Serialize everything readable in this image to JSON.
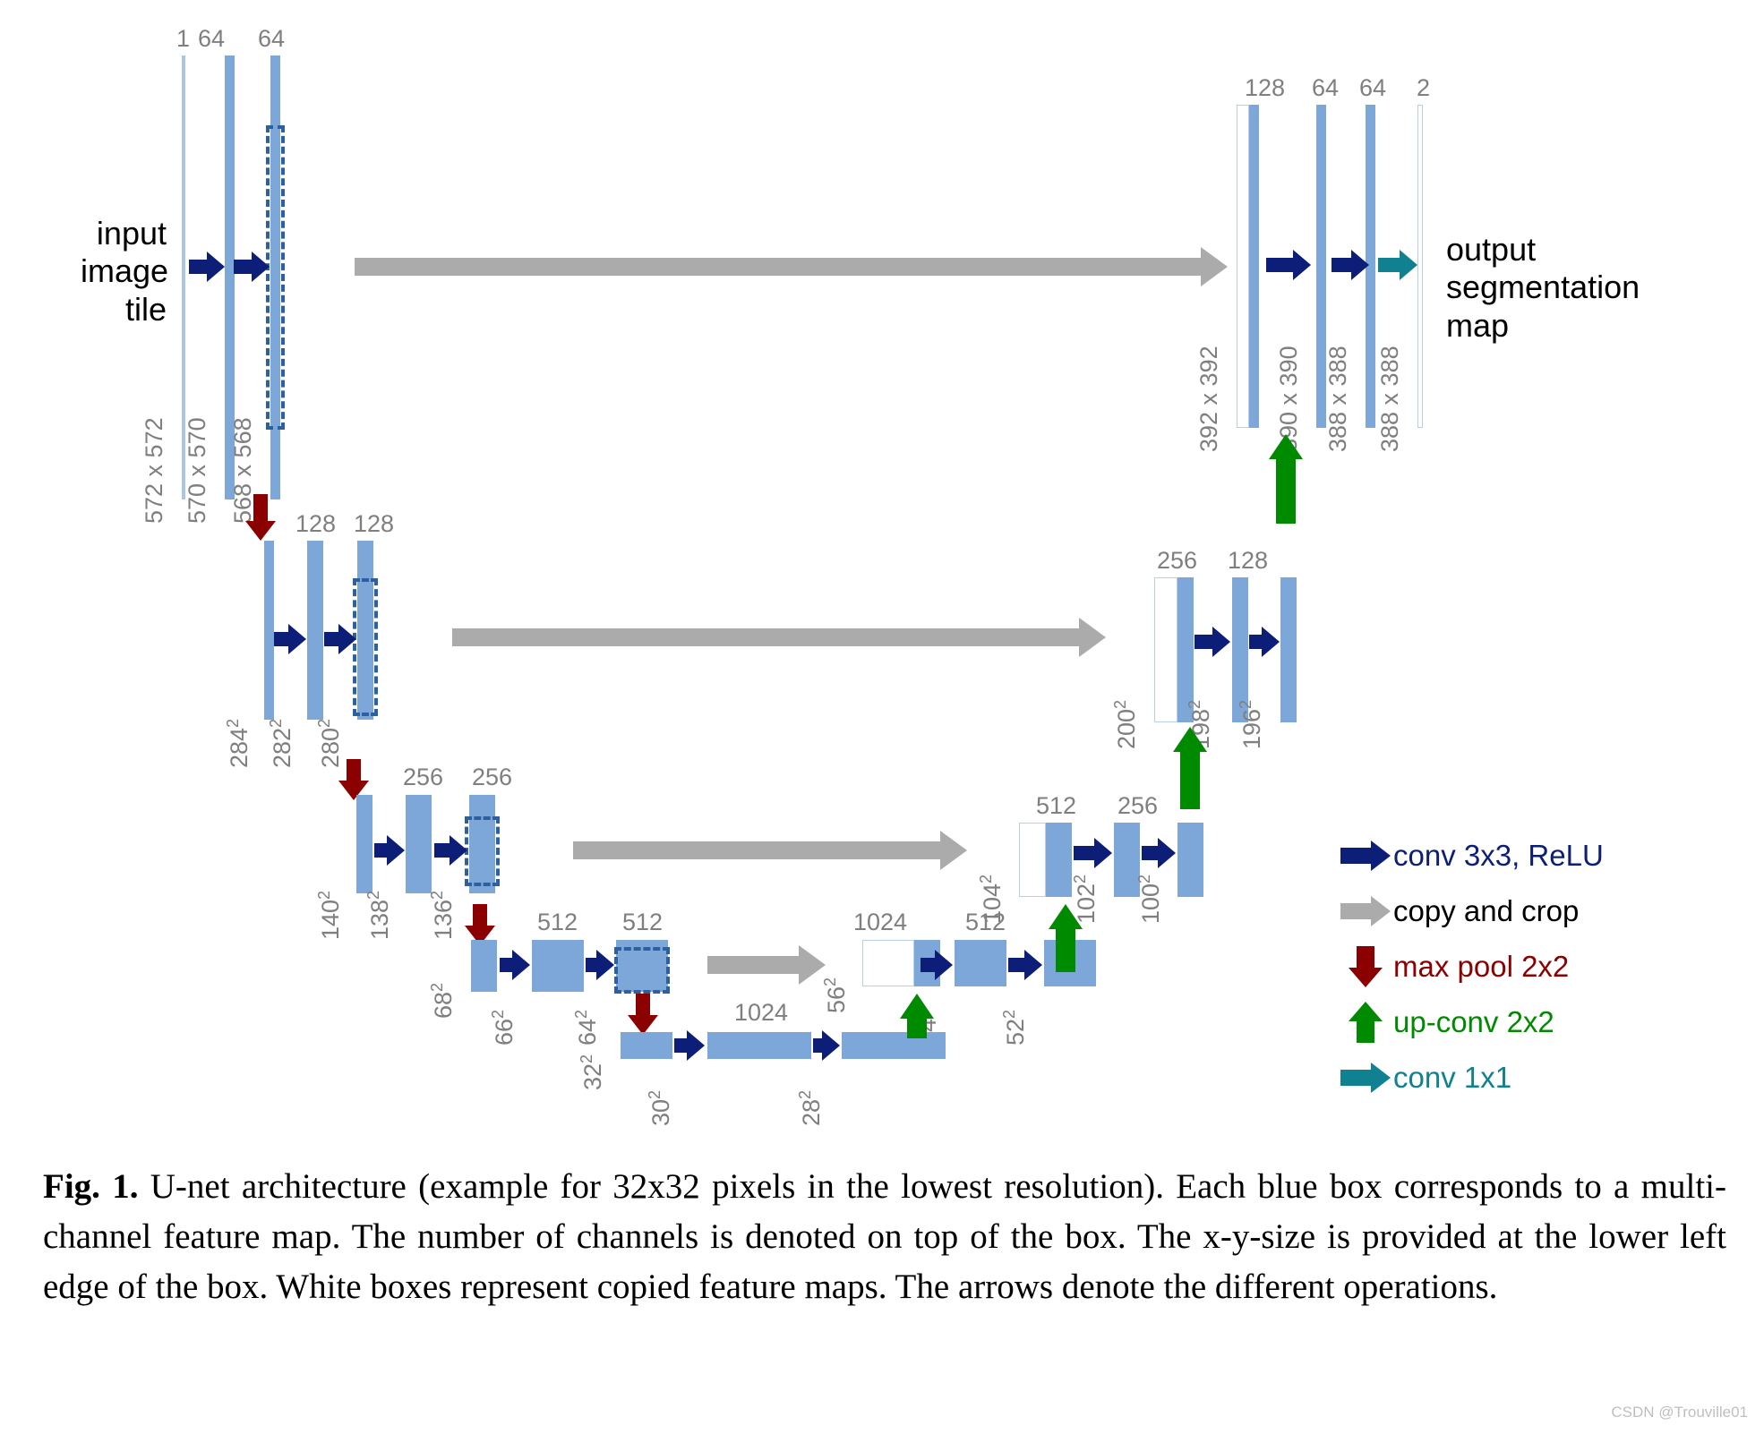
{
  "figure": {
    "caption_label": "Fig. 1.",
    "caption_text": "U-net architecture (example for 32x32 pixels in the lowest resolution). Each blue box corresponds to a multi-channel feature map. The number of channels is denoted on top of the box. The x-y-size is provided at the lower left edge of the box. White boxes represent copied feature maps. The arrows denote the different operations.",
    "watermark": "CSDN @Trouville01"
  },
  "annotations": {
    "input_label": "input\nimage\ntile",
    "input_line1": "input",
    "input_line2": "image",
    "input_line3": "tile",
    "output_line1": "output",
    "output_line2": "segmentation",
    "output_line3": "map"
  },
  "colors": {
    "feature_map_blue": "#7DA7D9",
    "channel_label_gray": "#7F7F7F",
    "conv_arrow": "#0D1E78",
    "copy_arrow": "#ABABAB",
    "maxpool_arrow": "#8B0000",
    "upconv_arrow": "#008A00",
    "conv1x1_arrow": "#0F8190",
    "white_box_border": "#B8CFE8",
    "dashed_border": "#2E5F9E"
  },
  "legend": [
    {
      "icon": "right-arrow-icon",
      "label": "conv 3x3, ReLU",
      "color": "#0D1E78"
    },
    {
      "icon": "right-arrow-icon",
      "label": "copy and crop",
      "color": "#ABABAB",
      "label_color": "#000000"
    },
    {
      "icon": "down-arrow-icon",
      "label": "max pool 2x2",
      "color": "#8B0000"
    },
    {
      "icon": "up-arrow-icon",
      "label": "up-conv 2x2",
      "color": "#008A00"
    },
    {
      "icon": "right-arrow-icon",
      "label": "conv 1x1",
      "color": "#0F8190"
    }
  ],
  "chart_data": {
    "type": "diagram",
    "title": "U-net architecture",
    "levels": [
      {
        "level": 1,
        "encoder": [
          {
            "channels": "1",
            "size": "572 x 572"
          },
          {
            "channels": "64",
            "size": "570 x 570"
          },
          {
            "channels": "64",
            "size": "568 x 568"
          }
        ],
        "decoder": [
          {
            "channels": "128",
            "size": "392 x 392",
            "copied": true
          },
          {
            "channels": "64",
            "size": "390 x 390"
          },
          {
            "channels": "64",
            "size": "388 x 388"
          },
          {
            "channels": "2",
            "size": "388 x 388"
          }
        ]
      },
      {
        "level": 2,
        "encoder": [
          {
            "channels": "",
            "size": "284²"
          },
          {
            "channels": "128",
            "size": "282²"
          },
          {
            "channels": "128",
            "size": "280²"
          }
        ],
        "decoder": [
          {
            "channels": "256",
            "size": "200²",
            "copied": true
          },
          {
            "channels": "128",
            "size": "198²"
          },
          {
            "channels": "",
            "size": "196²"
          }
        ]
      },
      {
        "level": 3,
        "encoder": [
          {
            "channels": "",
            "size": "140²"
          },
          {
            "channels": "256",
            "size": "138²"
          },
          {
            "channels": "256",
            "size": "136²"
          }
        ],
        "decoder": [
          {
            "channels": "512",
            "size": "104²",
            "copied": true
          },
          {
            "channels": "256",
            "size": "102²"
          },
          {
            "channels": "",
            "size": "100²"
          }
        ]
      },
      {
        "level": 4,
        "encoder": [
          {
            "channels": "",
            "size": "68²"
          },
          {
            "channels": "512",
            "size": "66²"
          },
          {
            "channels": "512",
            "size": "64²"
          }
        ],
        "decoder": [
          {
            "channels": "1024",
            "size": "56²",
            "copied": true
          },
          {
            "channels": "512",
            "size": "54²"
          },
          {
            "channels": "",
            "size": "52²"
          }
        ]
      },
      {
        "level": 5,
        "bottleneck": [
          {
            "channels": "",
            "size": "32²"
          },
          {
            "channels": "1024",
            "size": "30²"
          },
          {
            "channels": "",
            "size": "28²"
          }
        ]
      }
    ],
    "operations": [
      "conv 3x3, ReLU",
      "copy and crop",
      "max pool 2x2",
      "up-conv 2x2",
      "conv 1x1"
    ]
  },
  "labels": {
    "l1e": {
      "c1": "1",
      "c2": "64",
      "c3": "64",
      "s1": "572 x 572",
      "s2": "570 x 570",
      "s3": "568 x 568"
    },
    "l1d": {
      "c1": "128",
      "c2": "64",
      "c3": "64",
      "c4": "2",
      "s1": "392 x 392",
      "s2": "390 x 390",
      "s3": "388 x 388",
      "s4": "388 x 388"
    },
    "l2e": {
      "c2": "128",
      "c3": "128",
      "s1": "284",
      "s2": "282",
      "s3": "280"
    },
    "l2d": {
      "c1": "256",
      "c2": "128",
      "s1": "200",
      "s2": "198",
      "s3": "196"
    },
    "l3e": {
      "c2": "256",
      "c3": "256",
      "s1": "140",
      "s2": "138",
      "s3": "136"
    },
    "l3d": {
      "c1": "512",
      "c2": "256",
      "s1": "104",
      "s2": "102",
      "s3": "100"
    },
    "l4e": {
      "c2": "512",
      "c3": "512",
      "s1": "68",
      "s2": "66",
      "s3": "64"
    },
    "l4d": {
      "c1": "1024",
      "c2": "512",
      "s1": "56",
      "s2": "54",
      "s3": "52"
    },
    "l5": {
      "c2": "1024",
      "s1": "32",
      "s2": "30",
      "s3": "28"
    },
    "sup": "2"
  }
}
